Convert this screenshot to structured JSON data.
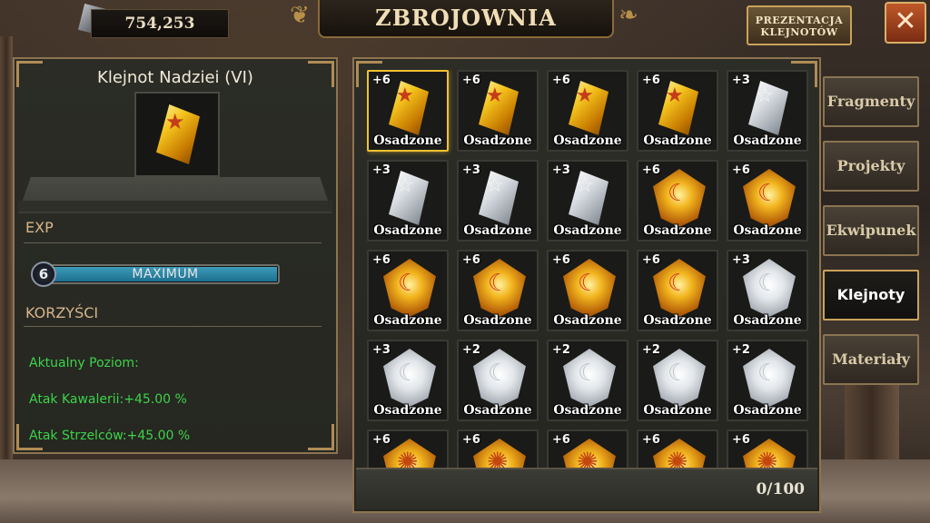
{
  "header": {
    "currency_value": "754,253",
    "title": "ZBROJOWNIA",
    "presentation_button": "PREZENTACJA KLEJNOTÓW",
    "close_label": "✕"
  },
  "detail": {
    "item_name": "Klejnot Nadziei (VI)",
    "exp_label": "EXP",
    "level": "6",
    "level_status": "MAXIMUM",
    "level_progress": 1.0,
    "benefits_label": "KORZYŚCI",
    "current_level_label": "Aktualny Poziom:",
    "bonuses": [
      "Atak Kawalerii:+45.00 %",
      "Atak Strzelców:+45.00 %"
    ]
  },
  "grid": {
    "count": "0/100",
    "slots": [
      {
        "level": "+6",
        "status": "Osadzone",
        "gem": "gold-crystal"
      },
      {
        "level": "+6",
        "status": "Osadzone",
        "gem": "gold-crystal"
      },
      {
        "level": "+6",
        "status": "Osadzone",
        "gem": "gold-crystal"
      },
      {
        "level": "+6",
        "status": "Osadzone",
        "gem": "gold-crystal"
      },
      {
        "level": "+3",
        "status": "Osadzone",
        "gem": "white-crystal"
      },
      {
        "level": "+3",
        "status": "Osadzone",
        "gem": "white-crystal"
      },
      {
        "level": "+3",
        "status": "Osadzone",
        "gem": "white-crystal"
      },
      {
        "level": "+3",
        "status": "Osadzone",
        "gem": "white-crystal"
      },
      {
        "level": "+6",
        "status": "Osadzone",
        "gem": "gold-moon-shield"
      },
      {
        "level": "+6",
        "status": "Osadzone",
        "gem": "gold-moon-shield"
      },
      {
        "level": "+6",
        "status": "Osadzone",
        "gem": "gold-moon-shield"
      },
      {
        "level": "+6",
        "status": "Osadzone",
        "gem": "gold-moon-shield"
      },
      {
        "level": "+6",
        "status": "Osadzone",
        "gem": "gold-moon-shield"
      },
      {
        "level": "+6",
        "status": "Osadzone",
        "gem": "gold-moon-shield"
      },
      {
        "level": "+3",
        "status": "Osadzone",
        "gem": "white-moon-shield"
      },
      {
        "level": "+3",
        "status": "Osadzone",
        "gem": "white-moon-shield"
      },
      {
        "level": "+2",
        "status": "Osadzone",
        "gem": "white-moon-shield"
      },
      {
        "level": "+2",
        "status": "Osadzone",
        "gem": "white-moon-shield"
      },
      {
        "level": "+2",
        "status": "Osadzone",
        "gem": "white-moon-shield"
      },
      {
        "level": "+2",
        "status": "Osadzone",
        "gem": "white-moon-shield"
      },
      {
        "level": "+6",
        "status": "",
        "gem": "gold-sun-shield"
      },
      {
        "level": "+6",
        "status": "",
        "gem": "gold-sun-shield"
      },
      {
        "level": "+6",
        "status": "",
        "gem": "gold-sun-shield"
      },
      {
        "level": "+6",
        "status": "",
        "gem": "gold-sun-shield"
      },
      {
        "level": "+6",
        "status": "",
        "gem": "gold-sun-shield"
      }
    ]
  },
  "tabs": [
    {
      "label": "Fragmenty",
      "active": false
    },
    {
      "label": "Projekty",
      "active": false
    },
    {
      "label": "Ekwipunek",
      "active": false
    },
    {
      "label": "Klejnoty",
      "active": true
    },
    {
      "label": "Materiały",
      "active": false
    }
  ],
  "colors": {
    "selected_border": "#f1c232",
    "bonus_text": "#3cd34a",
    "panel_border": "#8d7450"
  }
}
